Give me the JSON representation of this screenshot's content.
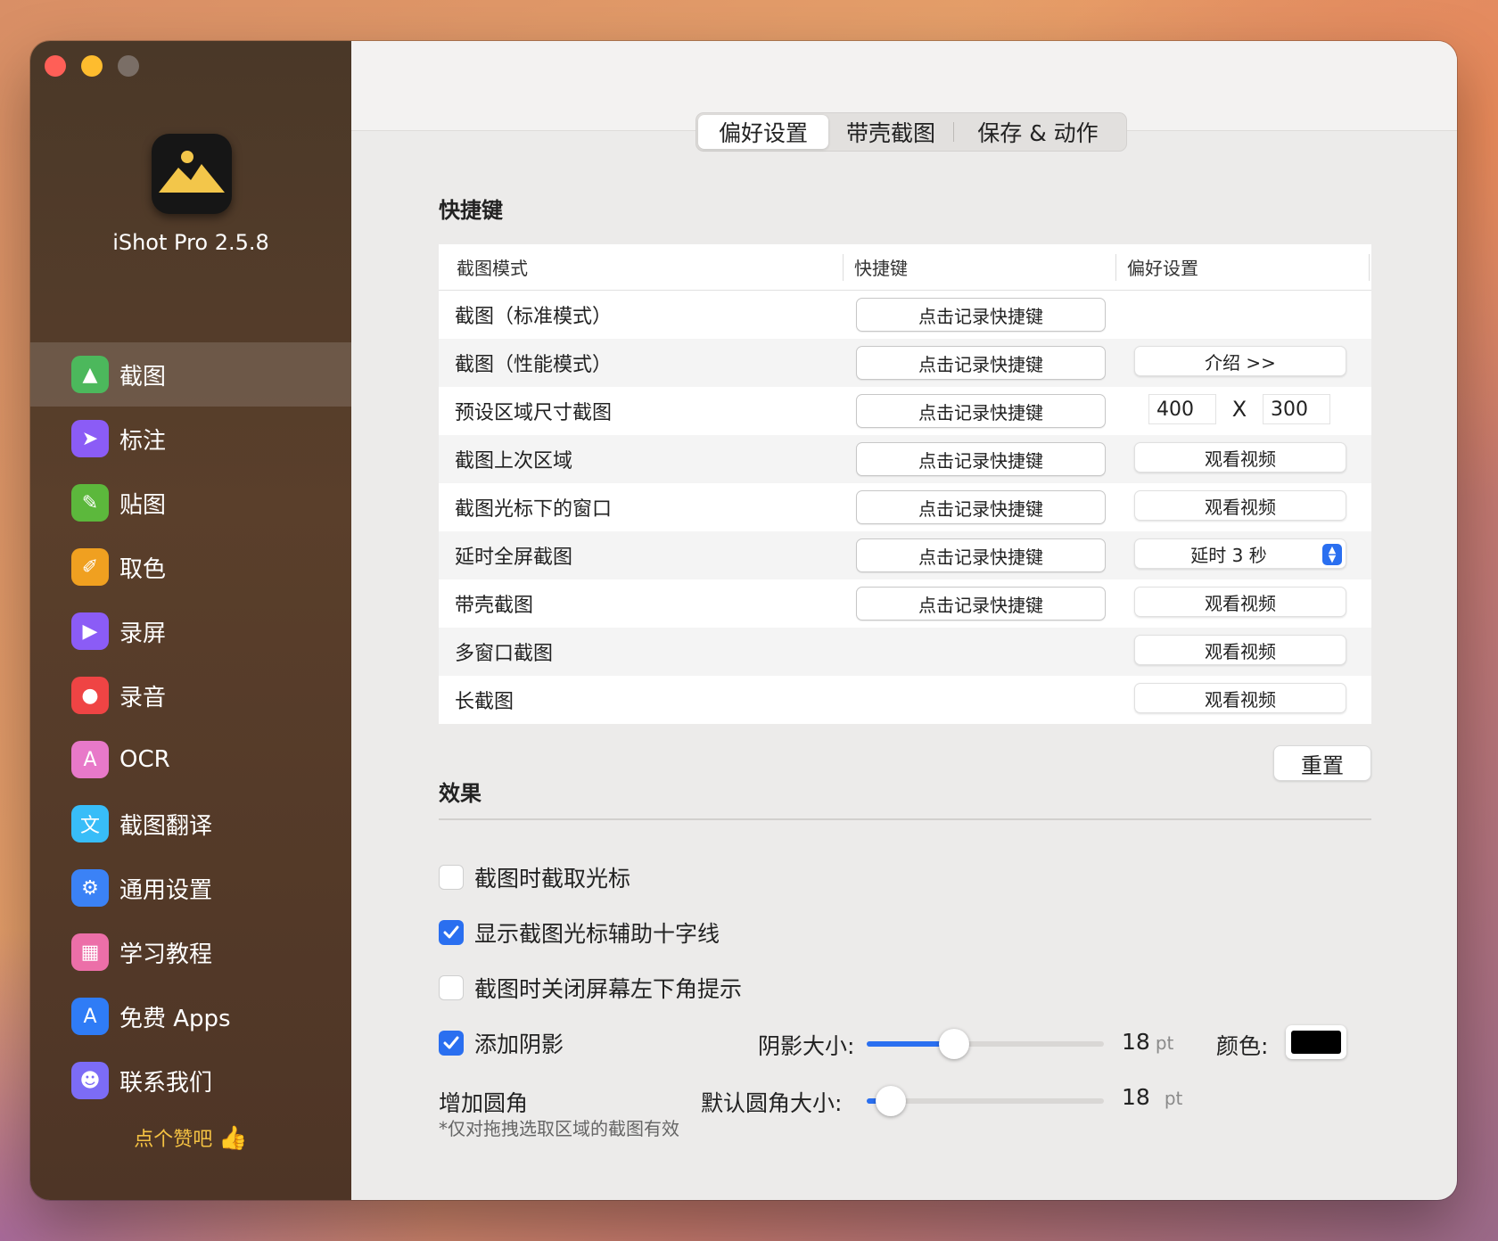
{
  "window": {
    "controls": [
      "close",
      "minimize",
      "zoom"
    ]
  },
  "sidebar": {
    "app_name": "iShot Pro 2.5.8",
    "items": [
      {
        "label": "截图",
        "icon": "image-icon",
        "color": "#4cb85c",
        "active": true
      },
      {
        "label": "标注",
        "icon": "cursor-icon",
        "color": "#8b5cf6"
      },
      {
        "label": "贴图",
        "icon": "pin-icon",
        "color": "#5cb83c"
      },
      {
        "label": "取色",
        "icon": "eyedropper-icon",
        "color": "#f0a020"
      },
      {
        "label": "录屏",
        "icon": "video-icon",
        "color": "#8b5cf6"
      },
      {
        "label": "录音",
        "icon": "microphone-icon",
        "color": "#ef4444"
      },
      {
        "label": "OCR",
        "icon": "ocr-icon",
        "color": "#e879c9"
      },
      {
        "label": "截图翻译",
        "icon": "translate-icon",
        "color": "#38bdf8"
      },
      {
        "label": "通用设置",
        "icon": "gear-icon",
        "color": "#3b82f6"
      },
      {
        "label": "学习教程",
        "icon": "tutorial-icon",
        "color": "#ec6fa8"
      },
      {
        "label": "免费 Apps",
        "icon": "appstore-icon",
        "color": "#2f7cf6"
      },
      {
        "label": "联系我们",
        "icon": "contacts-icon",
        "color": "#7c6cf6"
      }
    ],
    "like_text": "点个赞吧",
    "like_icon": "thumbs-up-icon"
  },
  "tabs": [
    {
      "label": "偏好设置",
      "active": true
    },
    {
      "label": "带壳截图",
      "active": false
    },
    {
      "label": "保存 & 动作",
      "active": false
    }
  ],
  "shortcuts": {
    "title": "快捷键",
    "headers": [
      "截图模式",
      "快捷键",
      "偏好设置"
    ],
    "record_label": "点击记录快捷键",
    "rows": [
      {
        "mode": "截图（标准模式）",
        "has_record": true,
        "pref_type": "none"
      },
      {
        "mode": "截图（性能模式）",
        "has_record": true,
        "pref_type": "button",
        "pref_label": "介绍 >>"
      },
      {
        "mode": "预设区域尺寸截图",
        "has_record": true,
        "pref_type": "size",
        "width": "400",
        "sep": "X",
        "height": "300"
      },
      {
        "mode": "截图上次区域",
        "has_record": true,
        "pref_type": "button",
        "pref_label": "观看视频"
      },
      {
        "mode": "截图光标下的窗口",
        "has_record": true,
        "pref_type": "button",
        "pref_label": "观看视频"
      },
      {
        "mode": "延时全屏截图",
        "has_record": true,
        "pref_type": "popup",
        "pref_label": "延时 3 秒"
      },
      {
        "mode": "带壳截图",
        "has_record": true,
        "pref_type": "button",
        "pref_label": "观看视频"
      },
      {
        "mode": "多窗口截图",
        "has_record": false,
        "pref_type": "button",
        "pref_label": "观看视频"
      },
      {
        "mode": "长截图",
        "has_record": false,
        "pref_type": "button",
        "pref_label": "观看视频"
      }
    ],
    "reset_label": "重置"
  },
  "effects": {
    "title": "效果",
    "capture_cursor": {
      "label": "截图时截取光标",
      "checked": false
    },
    "show_crosshair": {
      "label": "显示截图光标辅助十字线",
      "checked": true
    },
    "close_hint": {
      "label": "截图时关闭屏幕左下角提示",
      "checked": false
    },
    "shadow": {
      "label": "添加阴影",
      "checked": true,
      "size_label": "阴影大小:",
      "value": "18",
      "unit": "pt",
      "fraction": 0.37,
      "color_label": "颜色:",
      "color": "#000000"
    },
    "corner": {
      "label": "增加圆角",
      "size_label": "默认圆角大小:",
      "value": "18",
      "unit": "pt",
      "fraction": 0.1,
      "note": "*仅对拖拽选取区域的截图有效"
    }
  }
}
